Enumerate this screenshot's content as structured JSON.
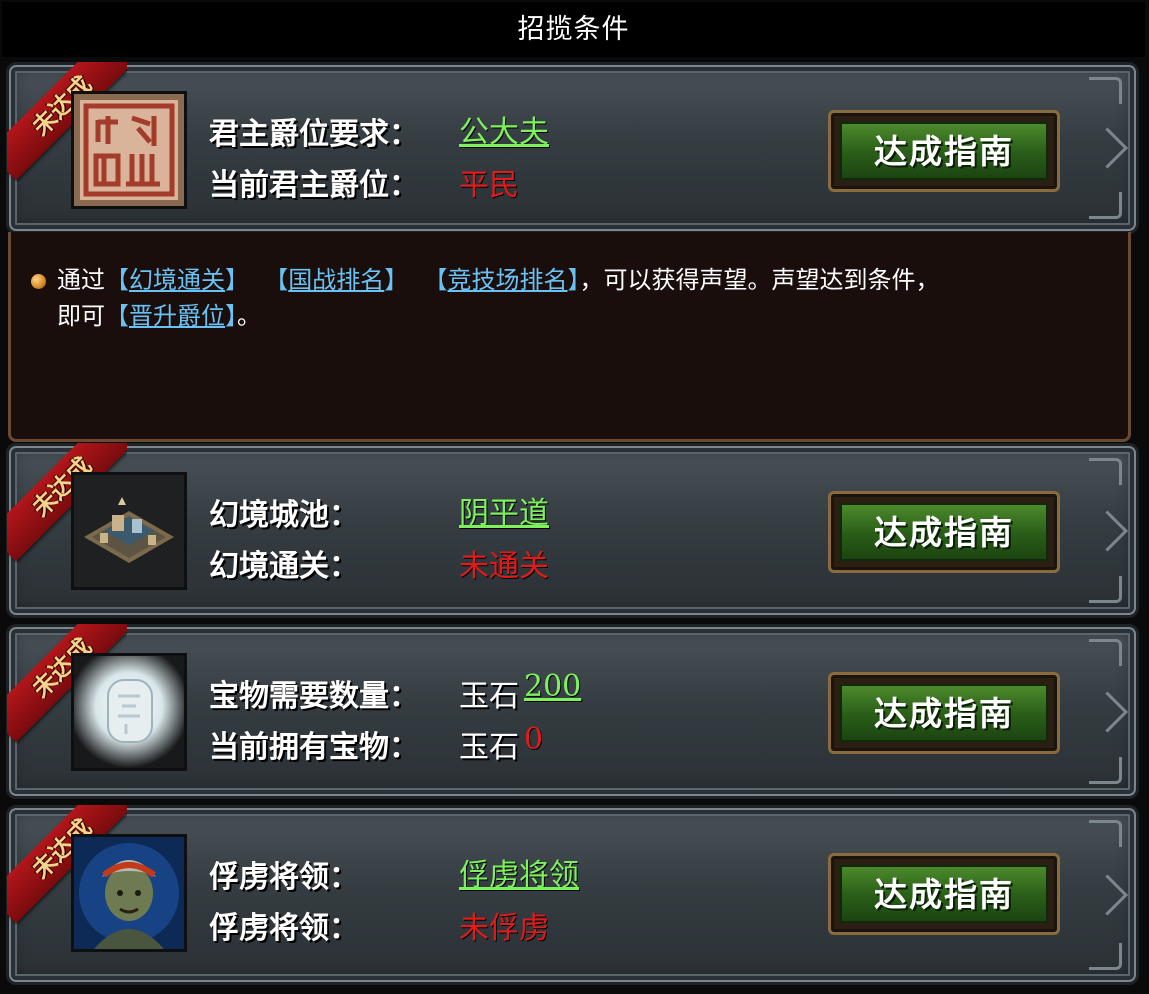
{
  "title": "招揽条件",
  "ribbon_label": "未达成",
  "guide_button_label": "达成指南",
  "conditions": [
    {
      "icon": "seal-icon",
      "req_label": "君主爵位要求：",
      "req_value": "公大夫",
      "cur_label": "当前君主爵位：",
      "cur_value": "平民"
    },
    {
      "icon": "city-icon",
      "req_label": "幻境城池：",
      "req_value": "阴平道",
      "cur_label": "幻境通关：",
      "cur_value": "未通关"
    },
    {
      "icon": "jade-icon",
      "req_label": "宝物需要数量：",
      "req_prefix": "玉石",
      "req_value": "200",
      "cur_label": "当前拥有宝物：",
      "cur_prefix": "玉石",
      "cur_value": "0"
    },
    {
      "icon": "general-portrait-icon",
      "req_label": "俘虏将领：",
      "req_value": "俘虏将领",
      "cur_label": "俘虏将领：",
      "cur_value": "未俘虏"
    }
  ],
  "info": {
    "t1": "通过",
    "l1_open": "【",
    "l1": "幻境通关",
    "l1_close": "】",
    "l2_open": "【",
    "l2": "国战排名",
    "l2_close": "】",
    "l3_open": "【",
    "l3": "竞技场排名",
    "l3_close": "】",
    "t2": "，可以获得声望。声望达到条件，",
    "t3": "即可",
    "l4_open": "【",
    "l4": "晋升爵位",
    "l4_close": "】",
    "t4": "。"
  },
  "colors": {
    "requirement": "#7cf35a",
    "current_unmet": "#e21a1a",
    "link": "#69c2f3",
    "ribbon": "#b2161a",
    "button": "#2b6019"
  }
}
